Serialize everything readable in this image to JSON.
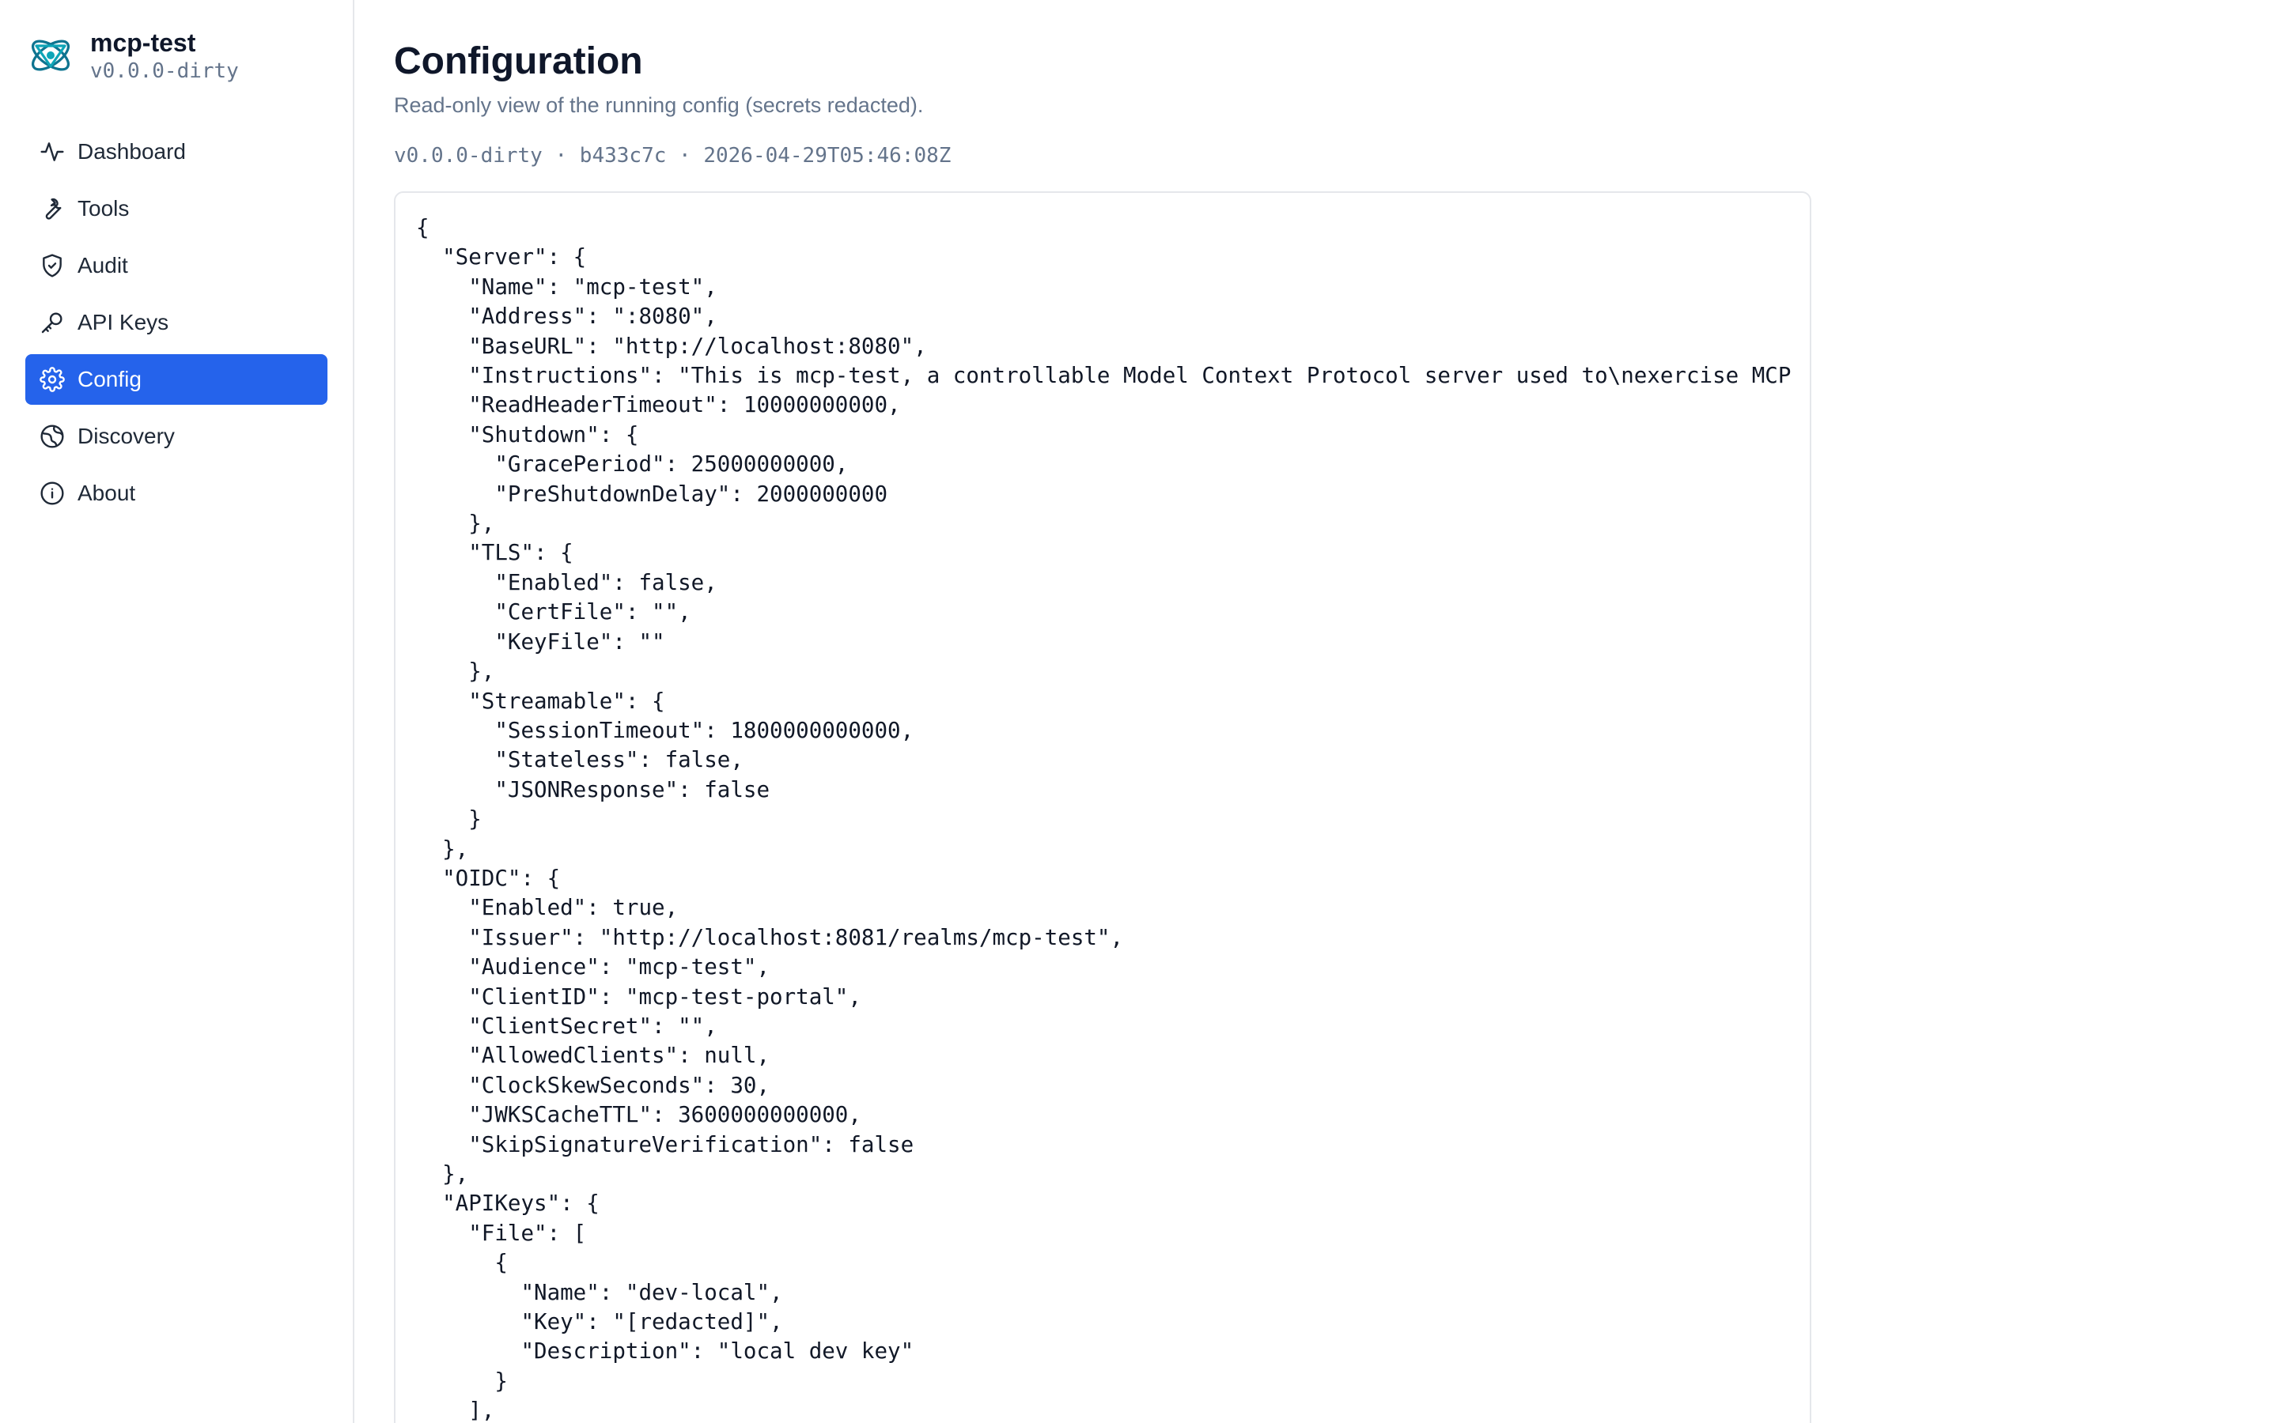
{
  "app": {
    "name": "mcp-test",
    "version": "v0.0.0-dirty"
  },
  "sidebar": {
    "items": [
      {
        "label": "Dashboard",
        "icon": "activity-icon",
        "active": false
      },
      {
        "label": "Tools",
        "icon": "wrench-icon",
        "active": false
      },
      {
        "label": "Audit",
        "icon": "shield-check-icon",
        "active": false
      },
      {
        "label": "API Keys",
        "icon": "key-icon",
        "active": false
      },
      {
        "label": "Config",
        "icon": "gear-icon",
        "active": true
      },
      {
        "label": "Discovery",
        "icon": "globe-icon",
        "active": false
      },
      {
        "label": "About",
        "icon": "info-icon",
        "active": false
      }
    ]
  },
  "page": {
    "title": "Configuration",
    "subtitle": "Read-only view of the running config (secrets redacted).",
    "build_info": "v0.0.0-dirty · b433c7c · 2026-04-29T05:46:08Z"
  },
  "config_lines": [
    "{",
    "  \"Server\": {",
    "    \"Name\": \"mcp-test\",",
    "    \"Address\": \":8080\",",
    "    \"BaseURL\": \"http://localhost:8080\",",
    "    \"Instructions\": \"This is mcp-test, a controllable Model Context Protocol server used to\\nexercise MCP",
    "    \"ReadHeaderTimeout\": 10000000000,",
    "    \"Shutdown\": {",
    "      \"GracePeriod\": 25000000000,",
    "      \"PreShutdownDelay\": 2000000000",
    "    },",
    "    \"TLS\": {",
    "      \"Enabled\": false,",
    "      \"CertFile\": \"\",",
    "      \"KeyFile\": \"\"",
    "    },",
    "    \"Streamable\": {",
    "      \"SessionTimeout\": 1800000000000,",
    "      \"Stateless\": false,",
    "      \"JSONResponse\": false",
    "    }",
    "  },",
    "  \"OIDC\": {",
    "    \"Enabled\": true,",
    "    \"Issuer\": \"http://localhost:8081/realms/mcp-test\",",
    "    \"Audience\": \"mcp-test\",",
    "    \"ClientID\": \"mcp-test-portal\",",
    "    \"ClientSecret\": \"\",",
    "    \"AllowedClients\": null,",
    "    \"ClockSkewSeconds\": 30,",
    "    \"JWKSCacheTTL\": 3600000000000,",
    "    \"SkipSignatureVerification\": false",
    "  },",
    "  \"APIKeys\": {",
    "    \"File\": [",
    "      {",
    "        \"Name\": \"dev-local\",",
    "        \"Key\": \"[redacted]\",",
    "        \"Description\": \"local dev key\"",
    "      }",
    "    ],"
  ],
  "colors": {
    "accent": "#2563eb",
    "logo": "#0e7490",
    "muted_text": "#64748b",
    "border": "#e5e7eb"
  }
}
